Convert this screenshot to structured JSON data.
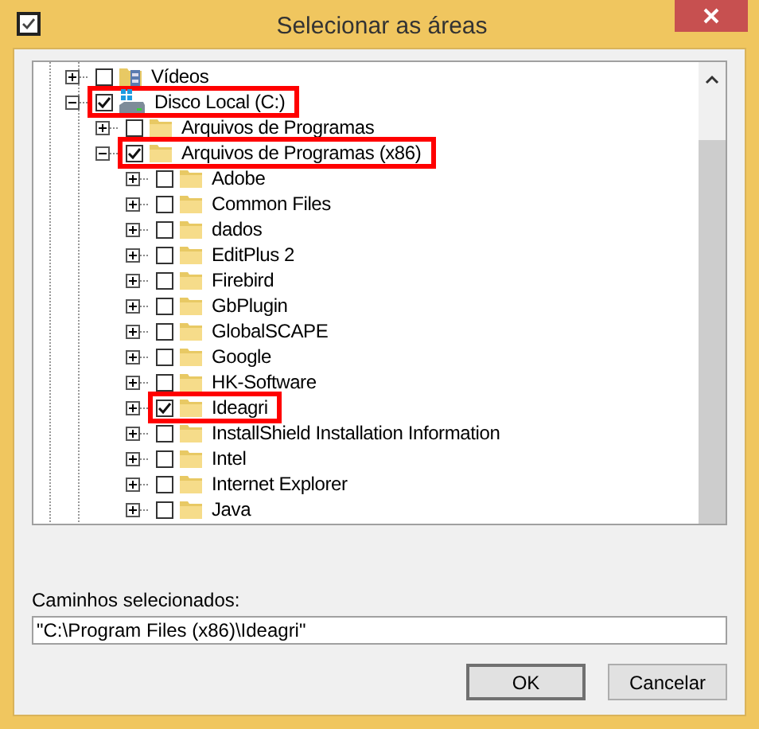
{
  "window": {
    "title": "Selecionar as áreas"
  },
  "tree": [
    {
      "label": "Vídeos",
      "kind": "videos",
      "expanded": false,
      "checked": false,
      "highlighted": false
    },
    {
      "label": "Disco Local (C:)",
      "kind": "drive",
      "expanded": true,
      "checked": true,
      "highlighted": true,
      "children": [
        {
          "label": "Arquivos de Programas",
          "kind": "folder",
          "expanded": false,
          "checked": false,
          "highlighted": false
        },
        {
          "label": "Arquivos de Programas (x86)",
          "kind": "folder",
          "expanded": true,
          "checked": true,
          "highlighted": true,
          "children": [
            {
              "label": "Adobe",
              "kind": "folder",
              "expanded": false,
              "checked": false,
              "highlighted": false
            },
            {
              "label": "Common Files",
              "kind": "folder",
              "expanded": false,
              "checked": false,
              "highlighted": false
            },
            {
              "label": "dados",
              "kind": "folder",
              "expanded": false,
              "checked": false,
              "highlighted": false
            },
            {
              "label": "EditPlus 2",
              "kind": "folder",
              "expanded": false,
              "checked": false,
              "highlighted": false
            },
            {
              "label": "Firebird",
              "kind": "folder",
              "expanded": false,
              "checked": false,
              "highlighted": false
            },
            {
              "label": "GbPlugin",
              "kind": "folder",
              "expanded": false,
              "checked": false,
              "highlighted": false
            },
            {
              "label": "GlobalSCAPE",
              "kind": "folder",
              "expanded": false,
              "checked": false,
              "highlighted": false
            },
            {
              "label": "Google",
              "kind": "folder",
              "expanded": false,
              "checked": false,
              "highlighted": false
            },
            {
              "label": "HK-Software",
              "kind": "folder",
              "expanded": false,
              "checked": false,
              "highlighted": false
            },
            {
              "label": "Ideagri",
              "kind": "folder",
              "expanded": false,
              "checked": true,
              "highlighted": true
            },
            {
              "label": "InstallShield Installation Information",
              "kind": "folder",
              "expanded": false,
              "checked": false,
              "highlighted": false
            },
            {
              "label": "Intel",
              "kind": "folder",
              "expanded": false,
              "checked": false,
              "highlighted": false
            },
            {
              "label": "Internet Explorer",
              "kind": "folder",
              "expanded": false,
              "checked": false,
              "highlighted": false
            },
            {
              "label": "Java",
              "kind": "folder",
              "expanded": false,
              "checked": false,
              "highlighted": false
            }
          ]
        }
      ]
    }
  ],
  "paths": {
    "label": "Caminhos selecionados:",
    "value": "\"C:\\Program Files (x86)\\Ideagri\""
  },
  "buttons": [
    "OK",
    "Cancelar"
  ]
}
